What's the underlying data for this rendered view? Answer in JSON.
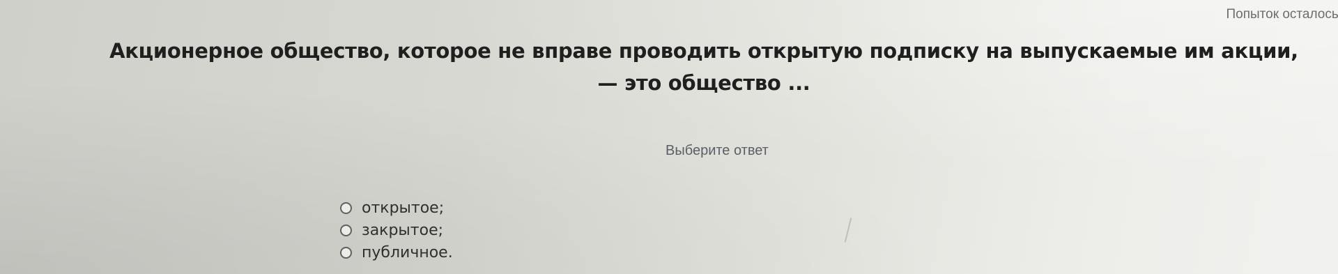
{
  "header": {
    "attempts_left": "Попыток осталось:"
  },
  "question": {
    "text": "Акционерное общество, которое не вправе проводить открытую подписку на выпускаемые им акции,— это общество ..."
  },
  "prompt": {
    "text": "Выберите ответ"
  },
  "options": [
    {
      "label": "открытое;"
    },
    {
      "label": "закрытое;"
    },
    {
      "label": "публичное."
    }
  ]
}
